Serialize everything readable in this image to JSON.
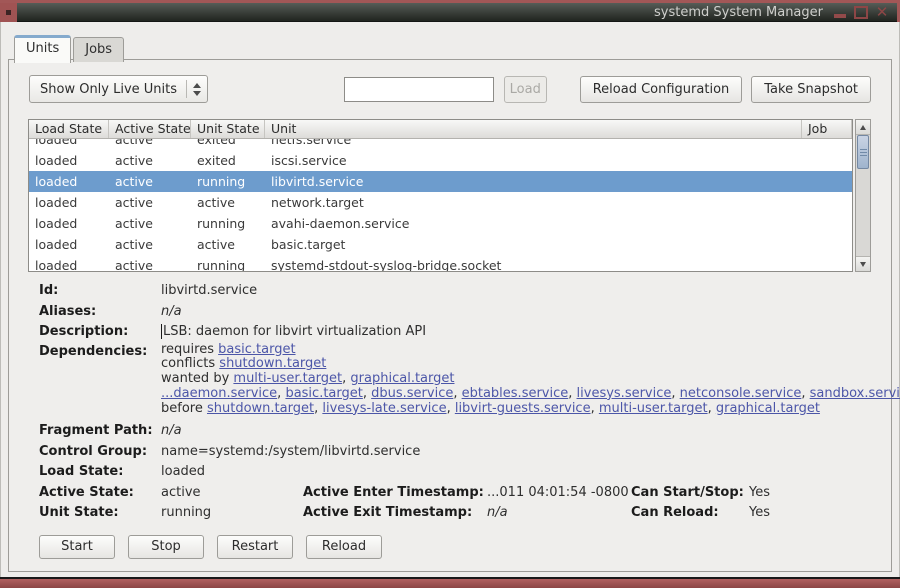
{
  "window": {
    "title": "systemd System Manager"
  },
  "tabs": [
    {
      "label": "Units",
      "active": true
    },
    {
      "label": "Jobs",
      "active": false
    }
  ],
  "toolbar": {
    "filter_select_value": "Show Only Live Units",
    "load_input_value": "",
    "load_button": "Load",
    "reload_config_button": "Reload Configuration",
    "take_snapshot_button": "Take Snapshot"
  },
  "units_table": {
    "columns": [
      "Load State",
      "Active State",
      "Unit State",
      "Unit",
      "Job"
    ],
    "rows": [
      {
        "load_state": "loaded",
        "active_state": "active",
        "unit_state": "exited",
        "unit": "netfs.service",
        "job": "",
        "selected": false
      },
      {
        "load_state": "loaded",
        "active_state": "active",
        "unit_state": "exited",
        "unit": "iscsi.service",
        "job": "",
        "selected": false
      },
      {
        "load_state": "loaded",
        "active_state": "active",
        "unit_state": "running",
        "unit": "libvirtd.service",
        "job": "",
        "selected": true
      },
      {
        "load_state": "loaded",
        "active_state": "active",
        "unit_state": "active",
        "unit": "network.target",
        "job": "",
        "selected": false
      },
      {
        "load_state": "loaded",
        "active_state": "active",
        "unit_state": "running",
        "unit": "avahi-daemon.service",
        "job": "",
        "selected": false
      },
      {
        "load_state": "loaded",
        "active_state": "active",
        "unit_state": "active",
        "unit": "basic.target",
        "job": "",
        "selected": false
      },
      {
        "load_state": "loaded",
        "active_state": "active",
        "unit_state": "running",
        "unit": "systemd-stdout-syslog-bridge.socket",
        "job": "",
        "selected": false
      }
    ]
  },
  "details": {
    "id_label": "Id:",
    "id": "libvirtd.service",
    "aliases_label": "Aliases:",
    "aliases": "n/a",
    "description_label": "Description:",
    "description": "LSB: daemon for libvirt virtualization API",
    "dependencies_label": "Dependencies:",
    "dependencies": [
      {
        "prefix": "requires ",
        "links": [
          "basic.target"
        ]
      },
      {
        "prefix": "conflicts ",
        "links": [
          "shutdown.target"
        ]
      },
      {
        "prefix": "wanted by ",
        "links": [
          "multi-user.target",
          "graphical.target"
        ]
      },
      {
        "prefix": "",
        "links": [
          "...daemon.service",
          "basic.target",
          "dbus.service",
          "ebtables.service",
          "livesys.service",
          "netconsole.service",
          "sandbox.service"
        ]
      },
      {
        "prefix": "before ",
        "links": [
          "shutdown.target",
          "livesys-late.service",
          "libvirt-guests.service",
          "multi-user.target",
          "graphical.target"
        ]
      }
    ],
    "fragment_path_label": "Fragment Path:",
    "fragment_path": "n/a",
    "control_group_label": "Control Group:",
    "control_group": "name=systemd:/system/libvirtd.service",
    "load_state_label": "Load State:",
    "load_state": "loaded",
    "active_state_label": "Active State:",
    "active_state": "active",
    "active_enter_label": "Active Enter Timestamp:",
    "active_enter": "...011 04:01:54 -0800",
    "can_start_stop_label": "Can Start/Stop:",
    "can_start_stop": "Yes",
    "unit_state_label": "Unit State:",
    "unit_state": "running",
    "active_exit_label": "Active Exit Timestamp:",
    "active_exit": "n/a",
    "can_reload_label": "Can Reload:",
    "can_reload": "Yes"
  },
  "actions": [
    "Start",
    "Stop",
    "Restart",
    "Reload"
  ],
  "colors": {
    "frame": "#a25757",
    "titlebar_top": "#565c57",
    "titlebar_bottom": "#20241f",
    "selection": "#6d9ccd",
    "link": "#4c56a8",
    "background": "#eeedeb"
  }
}
